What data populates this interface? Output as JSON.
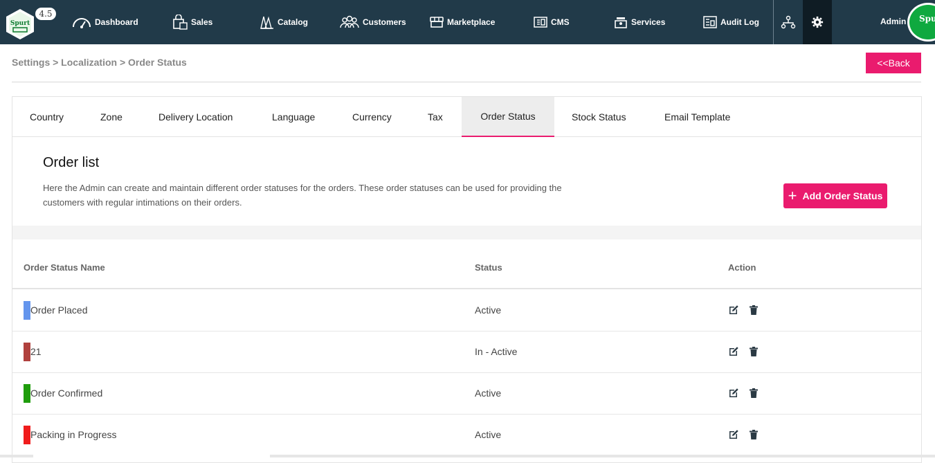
{
  "header": {
    "version": "4.5",
    "logo_text": "Spurt",
    "nav": [
      {
        "label": "Dashboard",
        "icon": "speedometer-icon"
      },
      {
        "label": "Sales",
        "icon": "shopping-bag-icon"
      },
      {
        "label": "Catalog",
        "icon": "catalog-icon"
      },
      {
        "label": "Customers",
        "icon": "users-icon"
      },
      {
        "label": "Marketplace",
        "icon": "store-icon"
      },
      {
        "label": "CMS",
        "icon": "cms-icon"
      },
      {
        "label": "Services",
        "icon": "services-icon"
      },
      {
        "label": "Audit Log",
        "icon": "audit-log-icon"
      }
    ],
    "admin_label": "Admin",
    "avatar_text": "Spurt"
  },
  "breadcrumb": "Settings > Localization > Order Status",
  "back_label": "<<Back",
  "tabs": [
    "Country",
    "Zone",
    "Delivery Location",
    "Language",
    "Currency",
    "Tax",
    "Order Status",
    "Stock Status",
    "Email Template"
  ],
  "active_tab": "Order Status",
  "section": {
    "title": "Order list",
    "description_line1": "Here the Admin can create and maintain different order statuses for the orders. These order statuses can be used for providing the",
    "description_line2": "customers with regular intimations on their orders.",
    "add_label": "Add Order Status"
  },
  "table": {
    "headers": [
      "Order Status Name",
      "Status",
      "Action"
    ],
    "rows": [
      {
        "name": "Order Placed",
        "status": "Active",
        "color": "#6495ed"
      },
      {
        "name": "21",
        "status": "In - Active",
        "color": "#b0413e"
      },
      {
        "name": "Order Confirmed",
        "status": "Active",
        "color": "#1f9d0c"
      },
      {
        "name": "Packing in Progress",
        "status": "Active",
        "color": "#f01c1c"
      }
    ]
  },
  "colors": {
    "topbar": "#213a49",
    "accent": "#ea1b6e"
  }
}
